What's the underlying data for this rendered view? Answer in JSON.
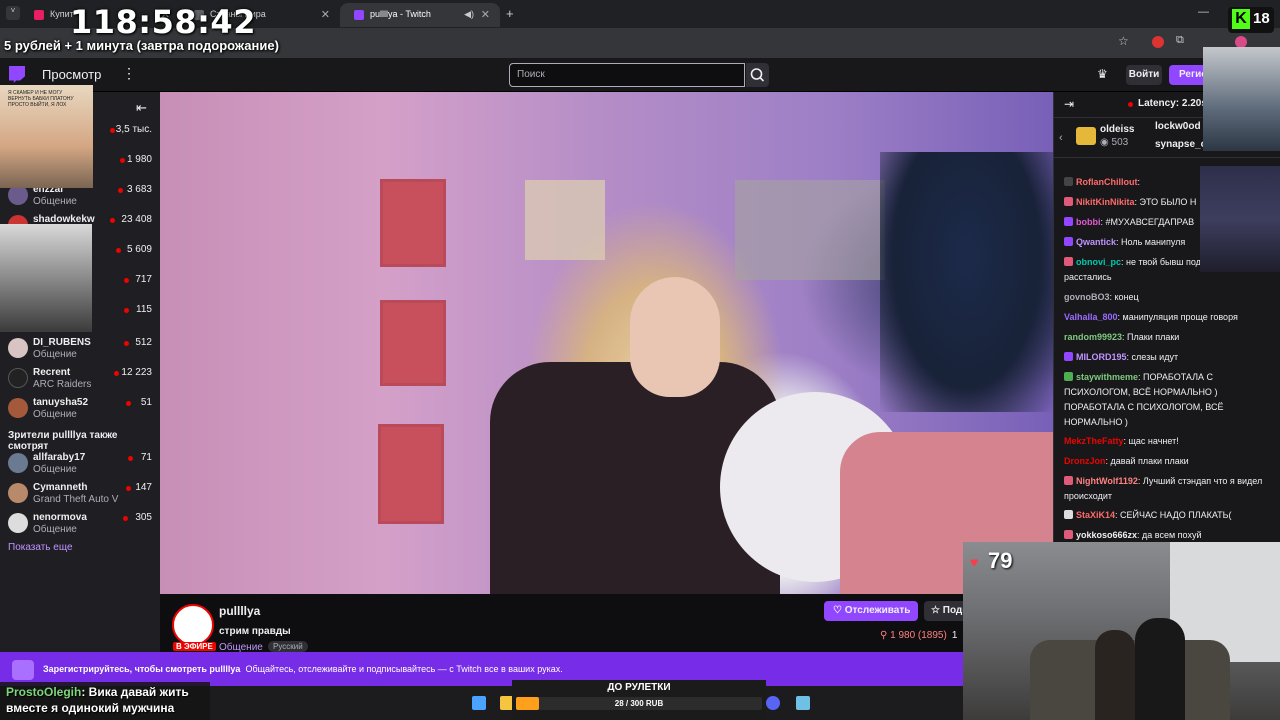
{
  "browser": {
    "tabs": [
      {
        "label": "Купит",
        "color": "#e91e63"
      },
      {
        "label": "Страны мира",
        "color": "#5f6368"
      },
      {
        "label": "pullllya - Twitch",
        "color": "#9147ff"
      }
    ],
    "new_tab": "+"
  },
  "overlay": {
    "timer": "118:58:42",
    "timer_sub": "5 рублей + 1 минута (завтра подорожание)",
    "kick_count": "18",
    "kick_letter": "K"
  },
  "topnav": {
    "browse": "Просмотр",
    "search_placeholder": "Поиск",
    "login": "Войти",
    "signup": "Регистрация"
  },
  "sidebar": {
    "channels": [
      {
        "name": "",
        "game": "",
        "viewers": "3,5 тыс.",
        "color": "#444"
      },
      {
        "name": "",
        "game": "",
        "viewers": "1 980",
        "color": "#444"
      },
      {
        "name": "enzzai",
        "game": "Общение",
        "viewers": "3 683",
        "color": "#6b5a8c"
      },
      {
        "name": "shadowkekw",
        "game": "",
        "viewers": "23 408",
        "color": "#c33"
      },
      {
        "name": "",
        "game": "",
        "viewers": "5 609",
        "color": "#444"
      },
      {
        "name": "",
        "game": "",
        "viewers": "717",
        "color": "#444"
      },
      {
        "name": "",
        "game": "",
        "viewers": "115",
        "color": "#444"
      },
      {
        "name": "DI_RUBENS",
        "game": "Общение",
        "viewers": "512",
        "color": "#d9c4c4"
      },
      {
        "name": "Recrent",
        "game": "ARC Raiders",
        "viewers": "12 223",
        "color": "#222"
      },
      {
        "name": "tanuysha52",
        "game": "Общение",
        "viewers": "51",
        "color": "#a45a3a"
      }
    ],
    "also_watch": "Зрители pullllya также смотрят",
    "also_channels": [
      {
        "name": "allfaraby17",
        "game": "Общение",
        "viewers": "71",
        "color": "#6a7a92"
      },
      {
        "name": "Cymanneth",
        "game": "Grand Theft Auto V",
        "viewers": "147",
        "color": "#b88a6a"
      },
      {
        "name": "nenormova",
        "game": "Общение",
        "viewers": "305",
        "color": "#ddd"
      }
    ],
    "show_more": "Показать еще"
  },
  "stream": {
    "name": "pullllya",
    "title": "стрим правды",
    "category": "Общение",
    "tag": "Русский",
    "live": "В ЭФИРЕ",
    "follow": "Отслеживать",
    "subscribe": "Подписаться",
    "viewers": "1 980 (1895)",
    "viewers_extra": "1"
  },
  "banner": {
    "bold": "Зарегистрируйтесь, чтобы смотреть pullllya",
    "rest": "Общайтесь, отслеживайте и подписывайтесь — с Twitch все в ваших руках."
  },
  "roulette": {
    "title": "ДО РУЛЕТКИ",
    "amount": "28 / 300 RUB",
    "progress": 0.093
  },
  "donation": {
    "user": "ProstoOlegih",
    "text": ": Вика давай жить вместе я одинокий мужчина"
  },
  "chat": {
    "latency": "Latency: 2.20s",
    "gift_top": {
      "name": "oldeiss",
      "count": "503"
    },
    "gift_others": [
      "lockw0od",
      "synapse_o"
    ],
    "messages": [
      {
        "user": "RoflanChillout",
        "text": ":",
        "color": "#ff6b6b",
        "badge": "#444"
      },
      {
        "user": "NikitKinNikita",
        "text": ": ЭТО БЫЛО Н",
        "color": "#ff6b6b",
        "badge": "#e25a7a"
      },
      {
        "user": "bobbi",
        "text": ": #МУХАВСЕГДАПРАВ",
        "color": "#e05ad0",
        "badge": "#9147ff"
      },
      {
        "user": "Qwantick",
        "text": ": Ноль манипуля",
        "color": "#bf94ff",
        "badge": "#9147ff"
      },
      {
        "user": "obnovi_pc",
        "text": ": не твой бывш подходит зря расстались",
        "color": "#00c8af",
        "badge": "#e25a7a"
      },
      {
        "user": "govnoBO3",
        "text": ": конец",
        "color": "#adadb8",
        "badge": ""
      },
      {
        "user": "Valhalla_800",
        "text": ": манипуляция проще говоря",
        "color": "#9a6bff",
        "badge": ""
      },
      {
        "user": "random99923",
        "text": ": Плаки плаки",
        "color": "#7ec97e",
        "badge": ""
      },
      {
        "user": "MILORD195",
        "text": ": слезы идут",
        "color": "#bf94ff",
        "badge": "#9147ff"
      },
      {
        "user": "staywithmeme",
        "text": ": ПОРАБОТАЛА С ПСИХОЛОГОМ, ВСЁ НОРМАЛЬНО ) ПОРАБОТАЛА С ПСИХОЛОГОМ, ВСЁ НОРМАЛЬНО )",
        "color": "#7ec97e",
        "badge": "#4caf50"
      },
      {
        "user": "MekzTheFatty",
        "text": ": щас начнет!",
        "color": "#eb0400",
        "badge": ""
      },
      {
        "user": "DronzJon",
        "text": ": давай плаки плаки",
        "color": "#eb0400",
        "badge": ""
      },
      {
        "user": "NightWolf1192",
        "text": ": Лучший стэндап что я видел происходит",
        "color": "#ff8280",
        "badge": "#e25a7a"
      },
      {
        "user": "StaXiK14",
        "text": ": СЕЙЧАС НАДО ПЛАКАТЬ(",
        "color": "#ff6b6b",
        "badge": "#ddd"
      },
      {
        "user": "yokkoso666zx",
        "text": ": да всем похуй",
        "color": "#efeff1",
        "badge": "#e25a7a"
      }
    ]
  },
  "webcam": {
    "hearts": "79"
  },
  "cam_caption": "Я СКАМЕР И НЕ МОГУ ВЕРНУТЬ БАБКИ ПЛАТОНУ ПРОСТО ВЫЙТИ, Я ЛОХ"
}
